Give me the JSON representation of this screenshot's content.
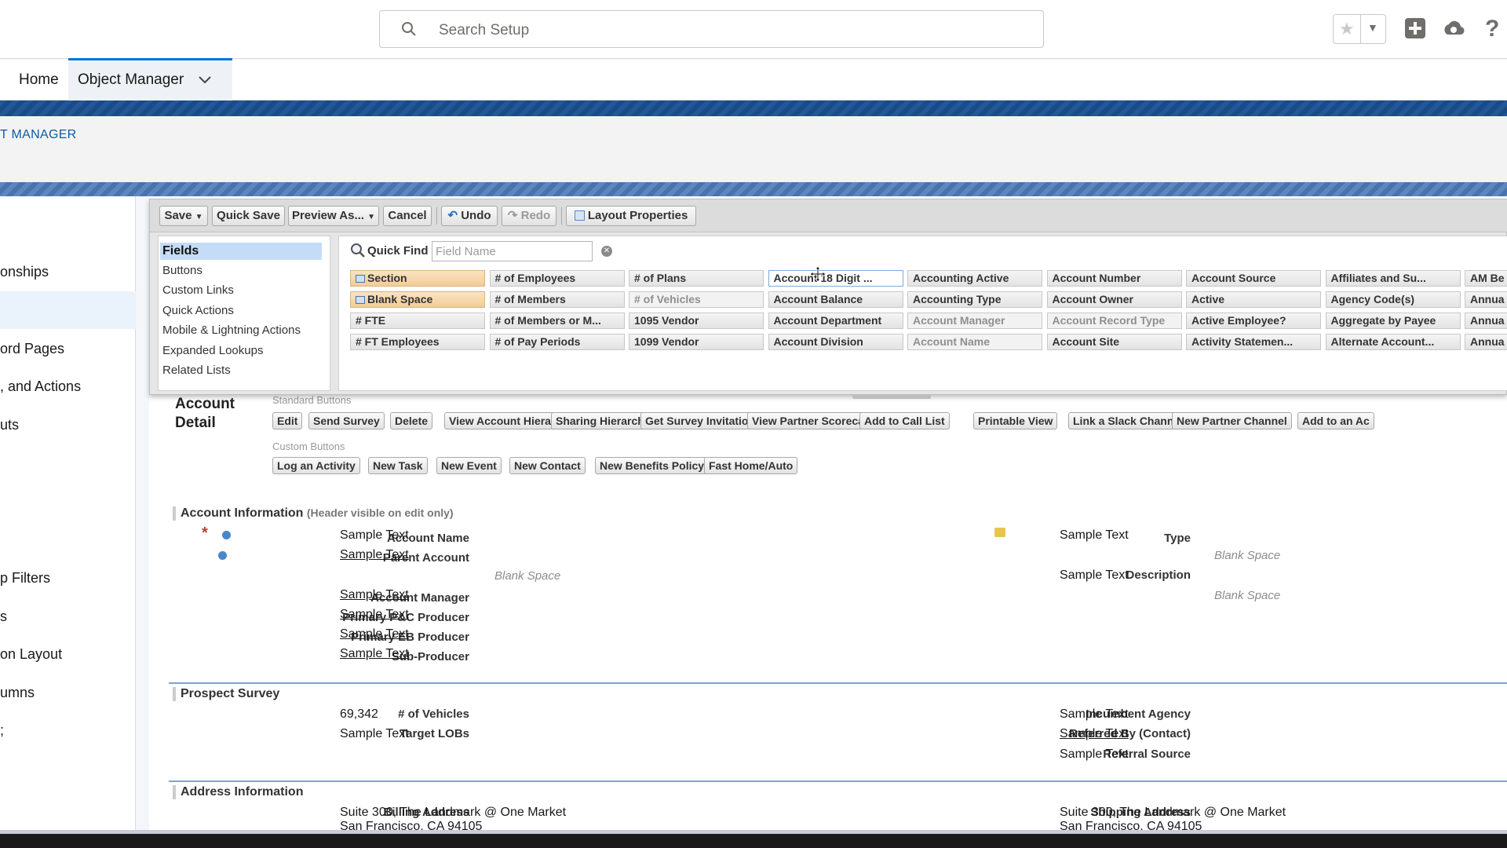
{
  "topbar": {
    "search_placeholder": "Search Setup",
    "help": "?"
  },
  "nav": {
    "home": "Home",
    "object_manager": "Object Manager"
  },
  "header": {
    "breadcrumb": "T MANAGER"
  },
  "sidebar": {
    "items": [
      "onships",
      "ord Pages",
      ", and Actions",
      "uts",
      "p Filters",
      "s",
      "on Layout",
      "umns",
      ";"
    ]
  },
  "toolbar": {
    "save": "Save",
    "quick_save": "Quick Save",
    "preview_as": "Preview As...",
    "cancel": "Cancel",
    "undo": "Undo",
    "redo": "Redo",
    "layout_properties": "Layout Properties"
  },
  "palette_categories": [
    "Fields",
    "Buttons",
    "Custom Links",
    "Quick Actions",
    "Mobile & Lightning Actions",
    "Expanded Lookups",
    "Related Lists"
  ],
  "quick_find": {
    "label": "Quick Find",
    "placeholder": "Field Name"
  },
  "field_columns": [
    [
      "Section",
      "Blank Space",
      "# FTE",
      "# FT Employees"
    ],
    [
      "# of Employees",
      "# of Members",
      "# of Members or M...",
      "# of Pay Periods"
    ],
    [
      "# of Plans",
      "# of Vehicles",
      "1095 Vendor",
      "1099 Vendor"
    ],
    [
      "Account 18 Digit ...",
      "Account Balance",
      "Account Department",
      "Account Division"
    ],
    [
      "Accounting Active",
      "Accounting Type",
      "Account Manager",
      "Account Name"
    ],
    [
      "Account Number",
      "Account Owner",
      "Account Record Type",
      "Account Site"
    ],
    [
      "Account Source",
      "Active",
      "Active Employee?",
      "Activity Statemen..."
    ],
    [
      "Affiliates and Su...",
      "Agency Code(s)",
      "Aggregate by Payee",
      "Alternate Account..."
    ],
    [
      "AM Be",
      "Annua",
      "Annua",
      "Annua"
    ]
  ],
  "detail": {
    "title_line1": "Account",
    "title_line2": "Detail",
    "standard_buttons_label": "Standard Buttons",
    "standard_buttons": [
      "Edit",
      "Send Survey",
      "Delete",
      "View Account Hierarchy",
      "Sharing Hierarchy",
      "Get Survey Invitation",
      "View Partner Scorecard",
      "Add to Call List",
      "Printable View",
      "Link a Slack Channel",
      "New Partner Channel",
      "Add to an Ac"
    ],
    "custom_buttons_label": "Custom Buttons",
    "custom_buttons": [
      "Log an Activity",
      "New Task",
      "New Event",
      "New Contact",
      "New Benefits Policy",
      "Fast Home/Auto"
    ]
  },
  "account_info": {
    "title": "Account Information",
    "note": "(Header visible on edit only)",
    "left": [
      {
        "label": "Account Name",
        "value": "Sample Text"
      },
      {
        "label": "Parent Account",
        "value": "Sample Text"
      },
      {
        "label": "Account Manager",
        "value": "Sample Text"
      },
      {
        "label": "Primary P&C Producer",
        "value": "Sample Text"
      },
      {
        "label": "Primary EB Producer",
        "value": "Sample Text"
      },
      {
        "label": "Sub-Producer",
        "value": "Sample Text"
      }
    ],
    "blank": "Blank Space",
    "right": [
      {
        "label": "Type",
        "value": "Sample Text"
      },
      {
        "label": "Description",
        "value": "Sample Text"
      }
    ]
  },
  "prospect": {
    "title": "Prospect Survey",
    "left": [
      {
        "label": "# of Vehicles",
        "value": "69,342"
      },
      {
        "label": "Target LOBs",
        "value": "Sample Text"
      }
    ],
    "right": [
      {
        "label": "Incumbent Agency",
        "value": "Sample Text"
      },
      {
        "label": "Referred By (Contact)",
        "value": "Sample Text"
      },
      {
        "label": "Referral Source",
        "value": "Sample Text"
      }
    ]
  },
  "address": {
    "title": "Address Information",
    "billing_label": "Billing Address",
    "billing_line1": "Suite 300, The Landmark @ One Market",
    "billing_line2": "San Francisco, CA 94105",
    "shipping_label": "Shipping Address",
    "shipping_line1": "Suite 300, The Landmark @ One Market",
    "shipping_line2": "San Francisco, CA 94105"
  }
}
